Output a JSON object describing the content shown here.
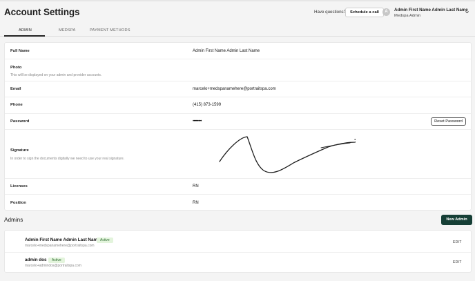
{
  "header": {
    "title": "Account Settings",
    "have_questions": "Have questions?",
    "schedule_label": "Schedule a call",
    "avatar_initial": "A",
    "user_name": "Admin First Name Admin Last Name",
    "user_role": "Medspa Admin"
  },
  "tabs": [
    "ADMIN",
    "MEDSPA",
    "PAYMENT METHODS"
  ],
  "account": {
    "full_name": {
      "label": "Full Name",
      "value": "Admin First Name Admin Last Name"
    },
    "photo": {
      "label": "Photo",
      "help": "This will be displayed on your admin and provider accounts."
    },
    "email": {
      "label": "Email",
      "value": "marcelo+medspanamehere@portraitspa.com"
    },
    "phone": {
      "label": "Phone",
      "value": "(415) 873-1599"
    },
    "password": {
      "label": "Password",
      "value": "••••••••",
      "reset_label": "Reset Password"
    },
    "signature": {
      "label": "Signature",
      "help": "In order to sign the documents digitally we need to use your real signature."
    },
    "licenses": {
      "label": "Licenses",
      "value": "RN"
    },
    "position": {
      "label": "Position",
      "value": "RN"
    }
  },
  "admins": {
    "title": "Admins",
    "new_label": "New Admin",
    "rows": [
      {
        "name": "Admin First Name Admin Last Name",
        "status": "Active",
        "email": "marcelo+medspanamehere@portraitspa.com",
        "edit": "EDIT"
      },
      {
        "name": "admin dos",
        "status": "Active",
        "email": "marcelo+admindos@portraitspa.com",
        "edit": "EDIT"
      }
    ]
  },
  "colors": {
    "primary_button": "#163f36",
    "active_badge_bg": "#e3f4dc",
    "active_badge_text": "#2c6b2f"
  },
  "icons": {
    "user_menu": "chevron-down-icon",
    "avatar": "avatar-initial"
  }
}
